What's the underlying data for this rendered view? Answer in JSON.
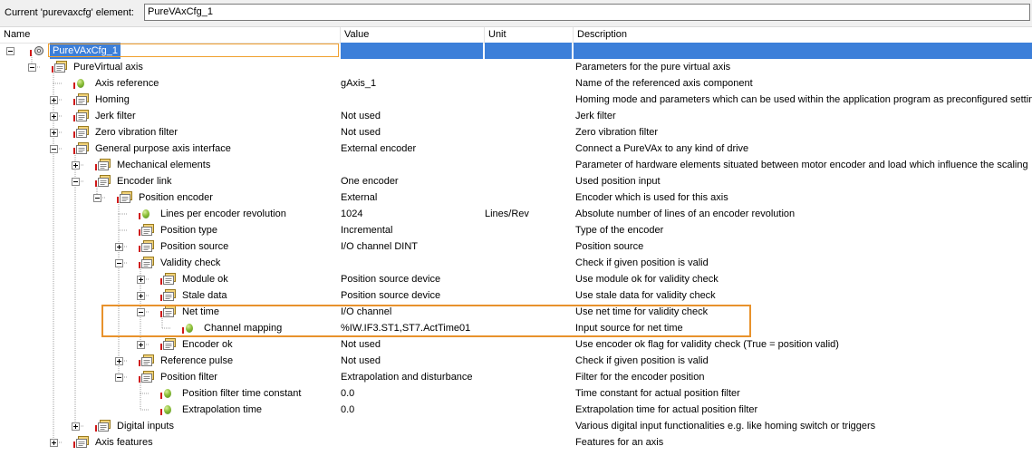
{
  "topbar": {
    "label": "Current 'purevaxcfg' element:",
    "value": "PureVAxCfg_1"
  },
  "columns": [
    "Name",
    "Value",
    "Unit",
    "Description"
  ],
  "rows": [
    {
      "level": 0,
      "expander": "minus",
      "icon": "gear-doc-icon",
      "name": "PureVAxCfg_1",
      "value": "",
      "unit": "",
      "desc": "",
      "selected": true
    },
    {
      "level": 1,
      "expander": "minus",
      "icon": "folder-param-icon",
      "name": "PureVirtual axis",
      "value": "",
      "unit": "",
      "desc": "Parameters for the pure virtual axis"
    },
    {
      "level": 2,
      "expander": "",
      "icon": "leaf-icon",
      "name": "Axis reference",
      "value": "gAxis_1",
      "unit": "",
      "desc": "Name of the referenced axis component"
    },
    {
      "level": 2,
      "expander": "plus",
      "icon": "folder-param-icon",
      "name": "Homing",
      "value": "",
      "unit": "",
      "desc": "Homing mode and parameters which can be used within the application program as preconfigured setting"
    },
    {
      "level": 2,
      "expander": "plus",
      "icon": "folder-param-icon",
      "name": "Jerk filter",
      "value": "Not used",
      "unit": "",
      "desc": "Jerk filter"
    },
    {
      "level": 2,
      "expander": "plus",
      "icon": "folder-param-icon",
      "name": "Zero vibration filter",
      "value": "Not used",
      "unit": "",
      "desc": "Zero vibration filter"
    },
    {
      "level": 2,
      "expander": "minus",
      "icon": "folder-param-icon",
      "name": "General purpose axis interface",
      "value": "External encoder",
      "unit": "",
      "desc": "Connect a PureVAx to any kind of drive"
    },
    {
      "level": 3,
      "expander": "plus",
      "icon": "folder-param-icon",
      "name": "Mechanical elements",
      "value": "",
      "unit": "",
      "desc": "Parameter of hardware elements situated between motor encoder and load which influence the scaling"
    },
    {
      "level": 3,
      "expander": "minus",
      "icon": "folder-param-icon",
      "name": "Encoder link",
      "value": "One encoder",
      "unit": "",
      "desc": "Used position input"
    },
    {
      "level": 4,
      "expander": "minus",
      "icon": "folder-param-icon",
      "name": "Position encoder",
      "value": "External",
      "unit": "",
      "desc": "Encoder which is used for this axis"
    },
    {
      "level": 5,
      "expander": "",
      "icon": "leaf-icon",
      "name": "Lines per encoder revolution",
      "value": "1024",
      "unit": "Lines/Rev",
      "desc": "Absolute number of lines of an encoder revolution"
    },
    {
      "level": 5,
      "expander": "",
      "icon": "folder-param-icon",
      "name": "Position type",
      "value": "Incremental",
      "unit": "",
      "desc": "Type of the encoder"
    },
    {
      "level": 5,
      "expander": "plus",
      "icon": "folder-param-icon",
      "name": "Position source",
      "value": "I/O channel DINT",
      "unit": "",
      "desc": "Position source"
    },
    {
      "level": 5,
      "expander": "minus",
      "icon": "folder-param-icon",
      "name": "Validity check",
      "value": "",
      "unit": "",
      "desc": "Check if given position is valid"
    },
    {
      "level": 6,
      "expander": "plus",
      "icon": "folder-param-icon",
      "name": "Module ok",
      "value": "Position source device",
      "unit": "",
      "desc": "Use module ok for validity check"
    },
    {
      "level": 6,
      "expander": "plus",
      "icon": "folder-param-icon",
      "name": "Stale data",
      "value": "Position source device",
      "unit": "",
      "desc": "Use stale data for validity check"
    },
    {
      "level": 6,
      "expander": "minus",
      "icon": "folder-param-icon",
      "name": "Net time",
      "value": "I/O channel",
      "unit": "",
      "desc": "Use net time for validity check"
    },
    {
      "level": 7,
      "expander": "",
      "icon": "leaf-icon",
      "name": "Channel mapping",
      "value": "%IW.IF3.ST1,ST7.ActTime01",
      "unit": "",
      "desc": "Input source for net time"
    },
    {
      "level": 6,
      "expander": "plus",
      "icon": "folder-param-icon",
      "name": "Encoder ok",
      "value": "Not used",
      "unit": "",
      "desc": "Use encoder ok flag for validity check (True = position valid)"
    },
    {
      "level": 5,
      "expander": "plus",
      "icon": "folder-param-icon",
      "name": "Reference pulse",
      "value": "Not used",
      "unit": "",
      "desc": "Check if given position is valid"
    },
    {
      "level": 5,
      "expander": "minus",
      "icon": "folder-param-icon",
      "name": "Position filter",
      "value": "Extrapolation and disturbance",
      "unit": "",
      "desc": "Filter for the encoder position"
    },
    {
      "level": 6,
      "expander": "",
      "icon": "leaf-icon",
      "name": "Position filter time constant",
      "value": "0.0",
      "unit": "",
      "desc": "Time constant for actual position filter"
    },
    {
      "level": 6,
      "expander": "",
      "icon": "leaf-icon",
      "name": "Extrapolation time",
      "value": "0.0",
      "unit": "",
      "desc": "Extrapolation time for actual position filter"
    },
    {
      "level": 3,
      "expander": "plus",
      "icon": "folder-param-icon",
      "name": "Digital inputs",
      "value": "",
      "unit": "",
      "desc": "Various digital input functionalities e.g. like homing switch or triggers"
    },
    {
      "level": 2,
      "expander": "plus",
      "icon": "folder-param-icon",
      "name": "Axis features",
      "value": "",
      "unit": "",
      "desc": "Features for an axis"
    }
  ],
  "colors": {
    "selection": "#3c7fd9",
    "highlight": "#e8922c",
    "marker": "#d01818"
  }
}
